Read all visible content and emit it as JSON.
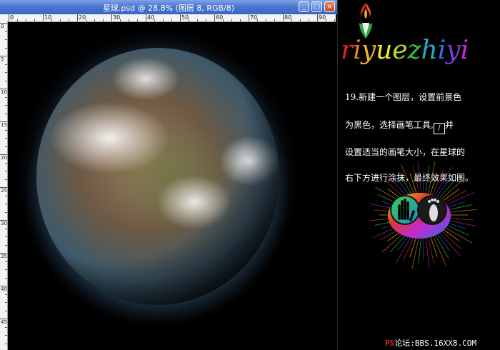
{
  "window": {
    "title": "星球.psd @ 28.8% (图层 8, RGB/8)",
    "minimize_glyph": "_",
    "maximize_glyph": "□",
    "close_glyph": "×"
  },
  "ruler": {
    "top_labels": [
      "0",
      "10",
      "20",
      "30",
      "40",
      "50",
      "60",
      "70",
      "80",
      "90"
    ],
    "left_labels": [
      "0",
      "5",
      "10",
      "15",
      "20",
      "25",
      "30",
      "35",
      "40",
      "45"
    ]
  },
  "brand": {
    "letters": [
      "r",
      "i",
      "y",
      "u",
      "e",
      "z",
      "h",
      "i",
      "y",
      "i"
    ],
    "colors": [
      "#e0262a",
      "#f07d2a",
      "#f2b21e",
      "#f7e62a",
      "#b8e02a",
      "#38c04a",
      "#2aa8c8",
      "#3a6fe0",
      "#7e3ad8",
      "#d02ad0"
    ]
  },
  "instructions": {
    "line1": "19.新建一个图层，设置前景色",
    "line2_a": "为黑色，选择画笔工具,",
    "line2_b": "并",
    "line3": "设置适当的画笔大小，在星球的",
    "line4": "右下方进行涂抹，最终效果如图。"
  },
  "brush_tool_icon": "brush-icon",
  "footer": {
    "ps": "PS",
    "text": "论坛:BBS.16XX8.COM"
  },
  "colors": {
    "titlebar": "#3a66c4",
    "footer_accent": "#e0281e"
  }
}
